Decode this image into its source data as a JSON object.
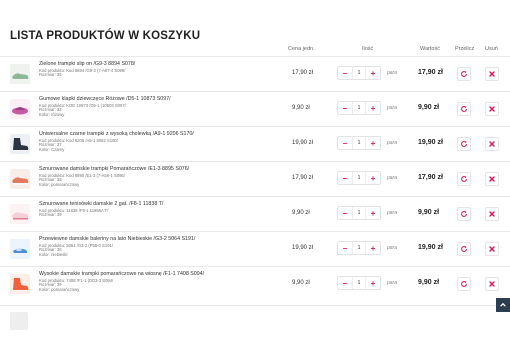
{
  "page": {
    "title": "LISTA PRODUKTÓW W KOSZYKU"
  },
  "columns": {
    "price": "Cena jedn.",
    "qty": "Ilość",
    "value": "Wartość",
    "recalc": "Przelicz",
    "remove": "Usuń"
  },
  "colors": {
    "accent": "#d81b60",
    "scroll_button": "#2c3e50"
  },
  "items": [
    {
      "name": "Zielone trampki slip on /G9-3 8894 S078/",
      "code": "Kod produktu: Kod 8894 /G9-3 (7-A67-4 S098/",
      "size": "Rozmiar: 35",
      "color": "",
      "price": "17,90 zł",
      "qty": "1",
      "unit": "para",
      "value": "17,90 zł",
      "image": "sneaker-icon-green"
    },
    {
      "name": "Gumowe klapki dziewczęce Różowe /D5-1 10873 S097/",
      "code": "Kod produktu: KOD 10873 /D5-1 (10503 S097/",
      "size": "Rozmiar: 32",
      "color": "Kolor: różowy",
      "price": "9,90 zł",
      "qty": "1",
      "unit": "para",
      "value": "9,90 zł",
      "image": "slipper-icon-pink"
    },
    {
      "name": "Uniwersalne czarne trampki z wysoką cholewką /A9-1 9206 S170/",
      "code": "Kod produktu: Kod 9206 /A9-1 8082 S180/",
      "size": "Rozmiar: 37",
      "color": "Kolor: Czarny",
      "price": "19,90 zł",
      "qty": "1",
      "unit": "para",
      "value": "19,90 zł",
      "image": "hightop-icon-black"
    },
    {
      "name": "Sznurowane damskie trampki Pomarańczowe /E1-3 8895 S076/",
      "code": "Kod produktu: Kod 8895 /E1-3 (7-A58-1 S096/",
      "size": "Rozmiar: 38",
      "color": "Kolor: pomarańczowy",
      "price": "17,90 zł",
      "qty": "1",
      "unit": "para",
      "value": "17,90 zł",
      "image": "sneaker-icon-orange"
    },
    {
      "name": "Sznurowane tenisówki damskie 2 gat. /F8-1 11838 T/",
      "code": "Kod produktu: 11838 /F8-1 11865A T/",
      "size": "Rozmiar: 39",
      "color": "",
      "price": "9,90 zł",
      "qty": "1",
      "unit": "para",
      "value": "9,90 zł",
      "image": "sneaker-icon-white"
    },
    {
      "name": "Przewiewne damskie baleriny na lato Niebieskie /G3-2 5064 S191/",
      "code": "Kod produktu: 5064 /G3-2 (P55-0 S191/",
      "size": "Rozmiar: 38",
      "color": "Kolor: niebieski",
      "price": "19,90 zł",
      "qty": "1",
      "unit": "para",
      "value": "19,90 zł",
      "image": "ballerina-icon-blue"
    },
    {
      "name": "Wysokie damskie trampki pomarańczowe na wiosnę /F1-1 7408 S094/",
      "code": "Kod produktu: 7408 /F1-1 (DD3-3 S094/",
      "size": "Rozmiar: 39",
      "color": "Kolor: pomarańczowy",
      "price": "9,90 zł",
      "qty": "1",
      "unit": "para",
      "value": "9,90 zł",
      "image": "hightop-icon-orange"
    }
  ],
  "icons": {
    "recalc": "refresh-icon",
    "remove": "close-icon",
    "scroll_top": "chevron-up-icon"
  }
}
